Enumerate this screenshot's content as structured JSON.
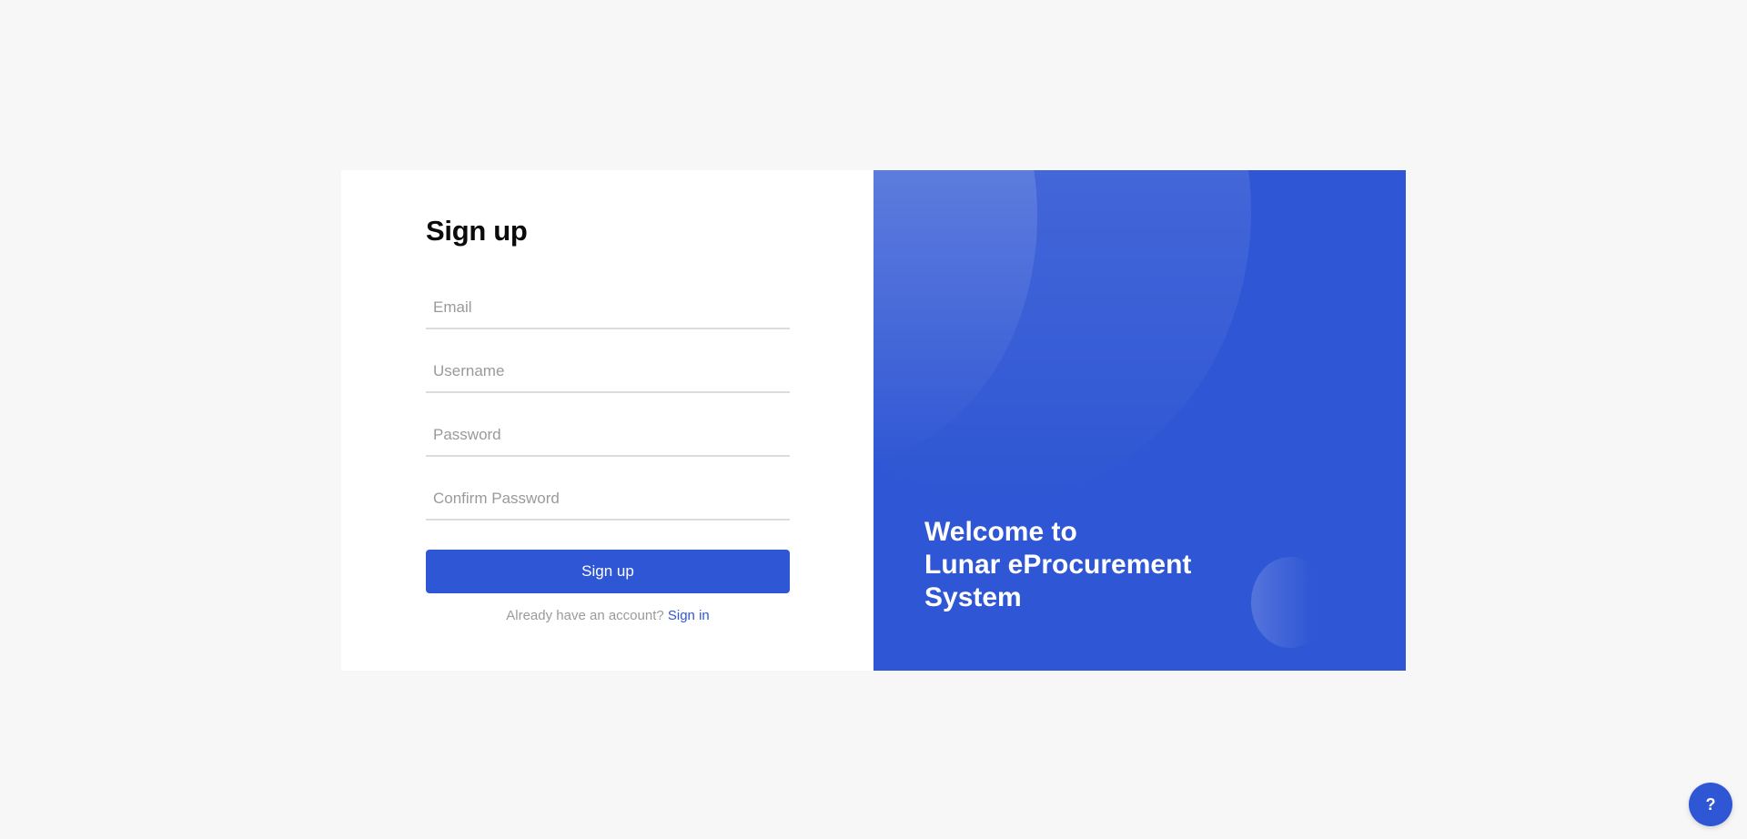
{
  "signup": {
    "title": "Sign up",
    "fields": [
      {
        "placeholder": "Email",
        "value": ""
      },
      {
        "placeholder": "Username",
        "value": ""
      },
      {
        "placeholder": "Password",
        "value": ""
      },
      {
        "placeholder": "Confirm Password",
        "value": ""
      }
    ],
    "submit_label": "Sign up",
    "signin_prompt": "Already have an account?",
    "signin_link": "Sign in"
  },
  "welcome": {
    "line1": "Welcome to",
    "line2": "Lunar eProcurement",
    "line3": "System"
  },
  "help": {
    "label": "?"
  },
  "colors": {
    "accent": "#2f56d4",
    "background": "#f7f7f7"
  }
}
